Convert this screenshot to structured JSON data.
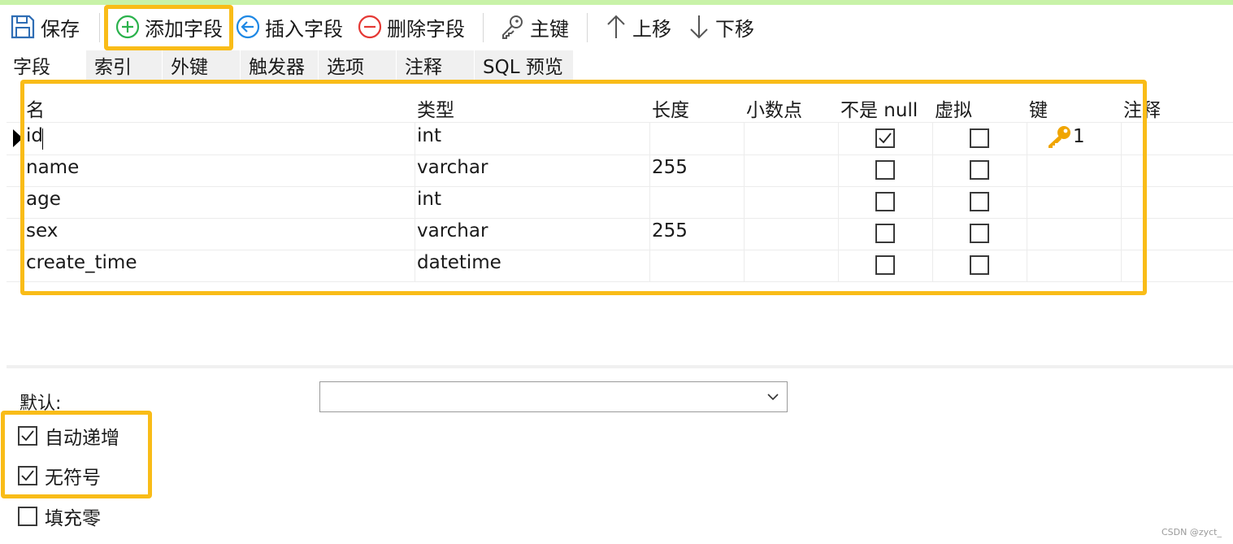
{
  "toolbar": {
    "save_label": "保存",
    "add_field_label": "添加字段",
    "insert_field_label": "插入字段",
    "delete_field_label": "删除字段",
    "primary_key_label": "主键",
    "move_up_label": "上移",
    "move_down_label": "下移"
  },
  "tabs": [
    {
      "label": "字段",
      "active": true
    },
    {
      "label": "索引"
    },
    {
      "label": "外键"
    },
    {
      "label": "触发器"
    },
    {
      "label": "选项"
    },
    {
      "label": "注释"
    },
    {
      "label": "SQL 预览"
    }
  ],
  "grid": {
    "columns": [
      "名",
      "类型",
      "长度",
      "小数点",
      "不是 null",
      "虚拟",
      "键",
      "注释"
    ],
    "rows": [
      {
        "name": "id",
        "type": "int",
        "length": "",
        "decimals": "",
        "not_null": true,
        "virtual": false,
        "key": "1"
      },
      {
        "name": "name",
        "type": "varchar",
        "length": "255",
        "decimals": "",
        "not_null": false,
        "virtual": false,
        "key": ""
      },
      {
        "name": "age",
        "type": "int",
        "length": "",
        "decimals": "",
        "not_null": false,
        "virtual": false,
        "key": ""
      },
      {
        "name": "sex",
        "type": "varchar",
        "length": "255",
        "decimals": "",
        "not_null": false,
        "virtual": false,
        "key": ""
      },
      {
        "name": "create_time",
        "type": "datetime",
        "length": "",
        "decimals": "",
        "not_null": false,
        "virtual": false,
        "key": ""
      }
    ]
  },
  "properties": {
    "default_label": "默认:",
    "default_value": "",
    "auto_increment_label": "自动递增",
    "auto_increment": true,
    "unsigned_label": "无符号",
    "unsigned": true,
    "zerofill_label": "填充零",
    "zerofill": false
  },
  "watermark": "CSDN @zyct_",
  "colors": {
    "highlight": "#f9bc18",
    "add_icon": "#2bb24c",
    "insert_icon": "#1e88e5",
    "delete_icon": "#e53935",
    "key_icon": "#f0a500",
    "top_strip": "#c8f2a8"
  },
  "icons": [
    "save-icon",
    "add-icon",
    "insert-icon",
    "delete-icon",
    "key-icon",
    "arrow-up-icon",
    "arrow-down-icon",
    "chevron-down-icon",
    "check-icon",
    "primary-key-icon"
  ]
}
